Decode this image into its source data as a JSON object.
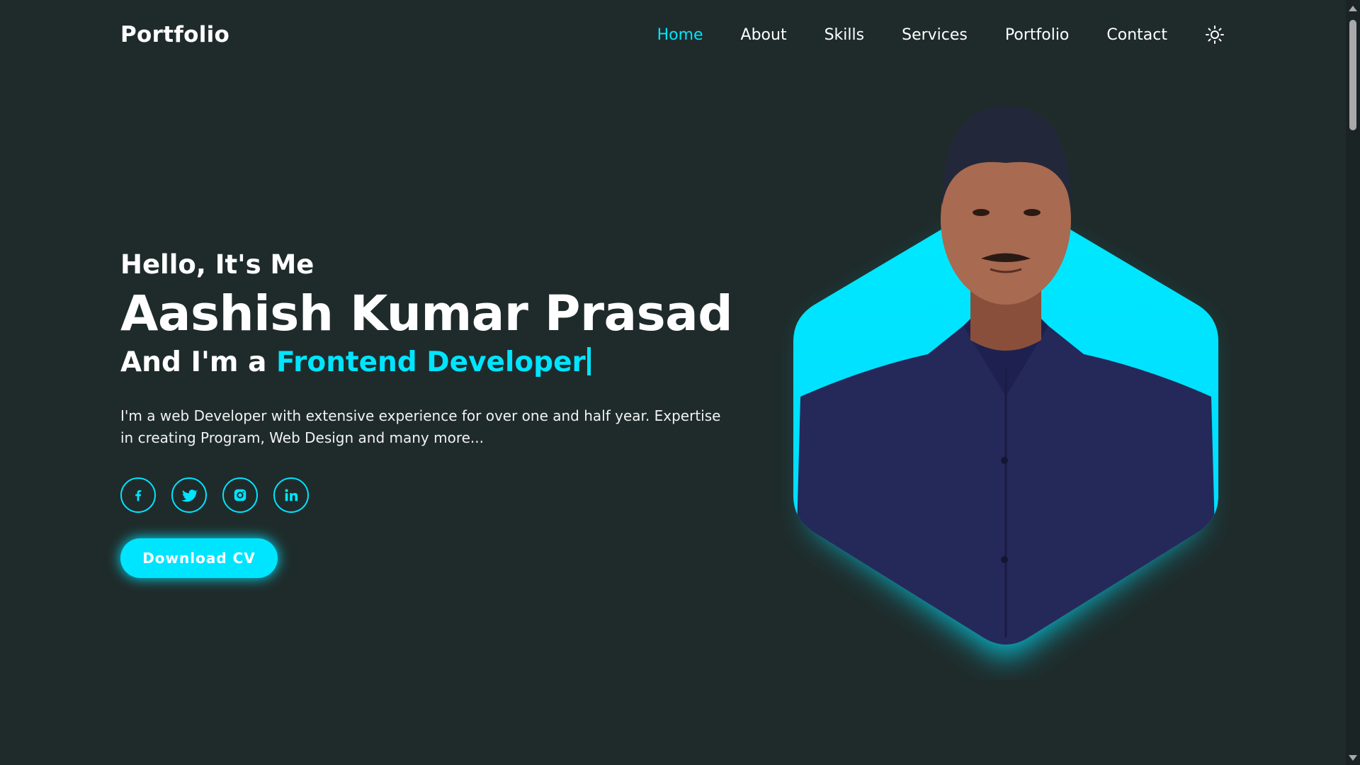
{
  "header": {
    "logo": "Portfolio",
    "nav": [
      {
        "label": "Home",
        "active": true
      },
      {
        "label": "About",
        "active": false
      },
      {
        "label": "Skills",
        "active": false
      },
      {
        "label": "Services",
        "active": false
      },
      {
        "label": "Portfolio",
        "active": false
      },
      {
        "label": "Contact",
        "active": false
      }
    ],
    "theme_icon": "sun-icon"
  },
  "hero": {
    "greeting": "Hello, It's Me",
    "name": "Aashish Kumar Prasad",
    "role_prefix": "And I'm a",
    "role_accent": "Frontend Developer",
    "description": "I'm a web Developer with extensive experience for over one and half year. Expertise in creating Program, Web Design and many more...",
    "socials": [
      {
        "icon": "facebook-icon"
      },
      {
        "icon": "twitter-icon"
      },
      {
        "icon": "instagram-icon"
      },
      {
        "icon": "linkedin-icon"
      }
    ],
    "cta_label": "Download CV",
    "image_icon": "profile-photo"
  },
  "colors": {
    "background": "#1f2b2b",
    "accent": "#00e5ff",
    "text": "#ffffff"
  }
}
